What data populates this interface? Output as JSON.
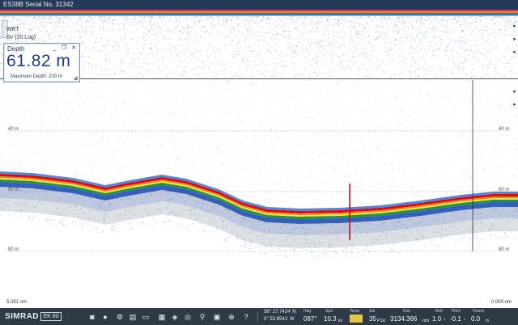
{
  "window": {
    "title": "ES38B Serial No. 31342"
  },
  "echogram": {
    "upper_label_1": "WBT",
    "upper_label_2": "Sv (20 Log)",
    "left_depth_labels": [
      "40 m",
      "60 m",
      "80 m"
    ],
    "right_depth_labels": [
      "40 m",
      "60 m",
      "80 m"
    ],
    "range_left": "5.091 nm",
    "range_right": "0.000 nm",
    "colors": {
      "bottom_red": "#c2141a",
      "orange": "#f07d25",
      "yellow": "#f4e14a",
      "green": "#2c8f3e",
      "blue": "#204fae",
      "grey": "#9aa3ae",
      "upper_stripe_top": "#b14b6c",
      "upper_stripe_mid": "#d6904c"
    }
  },
  "depth_panel": {
    "title": "Depth",
    "value": "61.82 m",
    "max_depth_label": "Maximum Depth:",
    "max_depth_value": "200 m",
    "btn_minimize": "_",
    "btn_restore": "❐",
    "btn_close": "✕"
  },
  "status_bar": {
    "brand": "SIMRAD",
    "model": "EK 80",
    "position": {
      "lat": "56° 27.7424' N",
      "lon": "0° 53.8541' W"
    },
    "hdg": {
      "label": "Hdg",
      "value": "087°"
    },
    "spd": {
      "label": "Spd",
      "value": "10.3"
    },
    "temp": {
      "label": "Temp"
    },
    "sal": {
      "label": "Sal",
      "value": "35"
    },
    "dist": {
      "label": "Dist",
      "value": "3134.366"
    },
    "roll": {
      "label": "Roll",
      "value": "1.0"
    },
    "pitch": {
      "label": "Pitch",
      "value": "-0.1"
    },
    "heave": {
      "label": "Heave",
      "value": "0.0"
    },
    "units": {
      "spd": "kn",
      "sal": "PSU",
      "dist": "nmi",
      "roll": "°",
      "pitch": "°",
      "heave": "m"
    }
  }
}
